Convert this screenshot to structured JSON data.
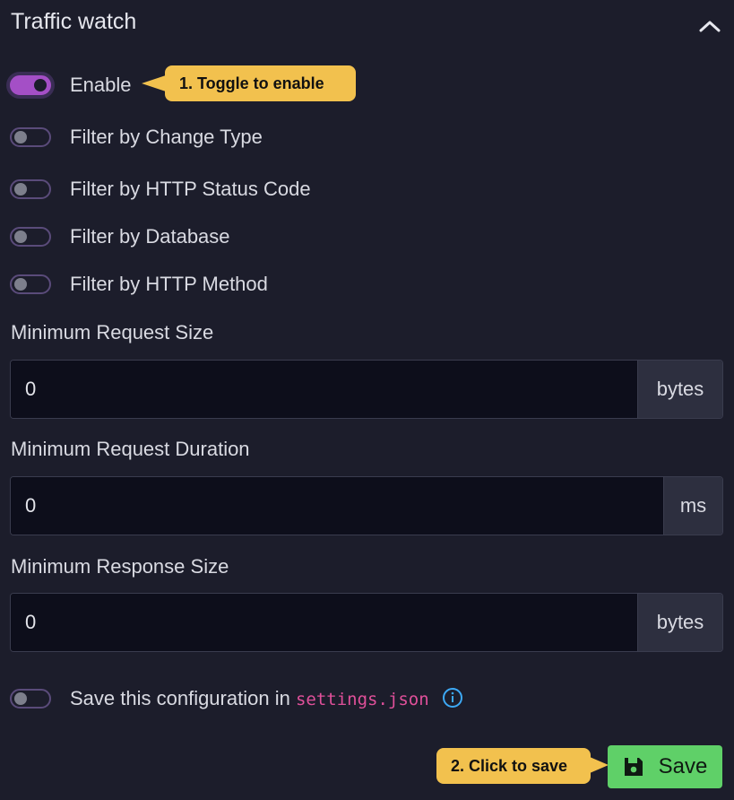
{
  "panel": {
    "title": "Traffic watch"
  },
  "toggles": {
    "enable": {
      "label": "Enable",
      "on": true
    },
    "change_type": {
      "label": "Filter by Change Type",
      "on": false
    },
    "status_code": {
      "label": "Filter by HTTP Status Code",
      "on": false
    },
    "database": {
      "label": "Filter by Database",
      "on": false
    },
    "http_method": {
      "label": "Filter by HTTP Method",
      "on": false
    },
    "save_config": {
      "label_prefix": "Save this configuration in ",
      "filename": "settings.json",
      "on": false
    }
  },
  "fields": {
    "min_request_size": {
      "label": "Minimum Request Size",
      "value": "0",
      "unit": "bytes"
    },
    "min_request_duration": {
      "label": "Minimum Request Duration",
      "value": "0",
      "unit": "ms"
    },
    "min_response_size": {
      "label": "Minimum Response Size",
      "value": "0",
      "unit": "bytes"
    }
  },
  "callouts": {
    "toggle_hint": "1. Toggle to enable",
    "save_hint": "2. Click to save"
  },
  "actions": {
    "save_label": "Save"
  },
  "icons": {
    "collapse": "chevron-up-icon",
    "info": "info-icon",
    "save": "floppy-disk-icon"
  },
  "colors": {
    "background": "#1c1d2b",
    "toggle_on": "#a44fc6",
    "callout": "#f2c14e",
    "save_button": "#5fd068",
    "filename": "#e0509a",
    "info": "#3da9f5"
  }
}
